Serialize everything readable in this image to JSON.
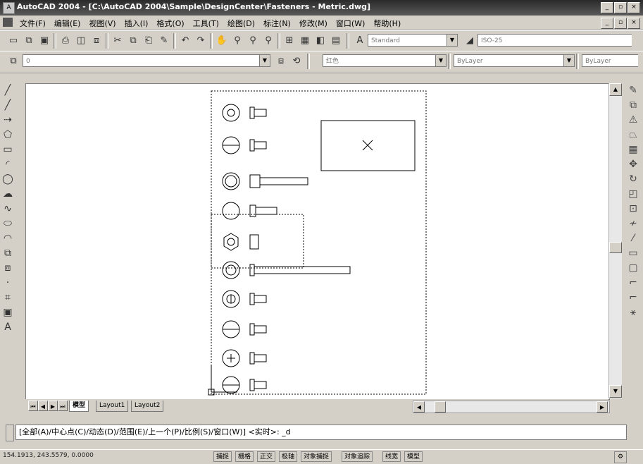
{
  "window": {
    "title": "AutoCAD 2004 - [C:\\AutoCAD 2004\\Sample\\DesignCenter\\Fasteners - Metric.dwg]",
    "controls": [
      "_",
      "▫",
      "×"
    ]
  },
  "menubar": {
    "items": [
      "文件(F)",
      "编辑(E)",
      "视图(V)",
      "插入(I)",
      "格式(O)",
      "工具(T)",
      "绘图(D)",
      "标注(N)",
      "修改(M)",
      "窗口(W)",
      "帮助(H)"
    ]
  },
  "styles_toolbar": {
    "text_style": "Standard",
    "dim_style": "ISO-25"
  },
  "layers_toolbar": {
    "layer": "0",
    "color": "红色",
    "linetype": "ByLayer",
    "lineweight": "ByLayer"
  },
  "icons": {
    "left": [
      "line-icon",
      "xline-icon",
      "pline-icon",
      "polygon-icon",
      "rectangle-icon",
      "arc-icon",
      "circle-icon",
      "revcloud-icon",
      "spline-icon",
      "ellipse-icon",
      "ellipse-arc-icon",
      "insert-block-icon",
      "make-block-icon",
      "point-icon",
      "hatch-icon",
      "region-icon",
      "mtext-icon"
    ],
    "left_glyphs": [
      "╱",
      "╱",
      "⇢",
      "⬠",
      "▭",
      "◜",
      "◯",
      "☁",
      "∿",
      "⬭",
      "◠",
      "⧉",
      "⧈",
      "·",
      "⌗",
      "▣",
      "A"
    ],
    "right": [
      "erase-icon",
      "copy-icon",
      "mirror-icon",
      "offset-icon",
      "array-icon",
      "move-icon",
      "rotate-icon",
      "scale-icon",
      "stretch-icon",
      "trim-icon",
      "extend-icon",
      "break-point-icon",
      "break-icon",
      "chamfer-icon",
      "fillet-icon",
      "explode-icon"
    ],
    "right_glyphs": [
      "✎",
      "⧉",
      "⚠",
      "⏢",
      "▦",
      "✥",
      "↻",
      "◰",
      "⊡",
      "≁",
      "⁄",
      "▭",
      "▢",
      "⌐",
      "⌐",
      "⚹"
    ]
  },
  "tabs": [
    "模型",
    "Layout1",
    "Layout2"
  ],
  "command_line": {
    "prompt": "[全部(A)/中心点(C)/动态(D)/范围(E)/上一个(P)/比例(S)/窗口(W)] <实时>: _d"
  },
  "status_bar": {
    "coords": "154.1913, 243.5579, 0.0000",
    "modes": [
      "捕捉",
      "栅格",
      "正交",
      "极轴",
      "对象捕捉",
      "对象追踪",
      "线宽",
      "模型"
    ]
  }
}
